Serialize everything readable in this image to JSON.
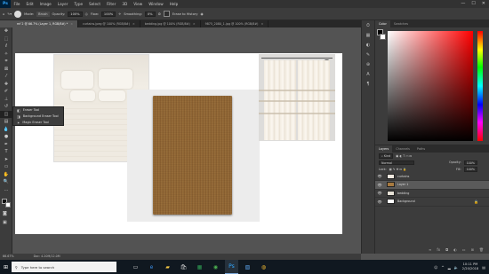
{
  "menubar": {
    "logo": "Ps",
    "items": [
      "File",
      "Edit",
      "Image",
      "Layer",
      "Type",
      "Select",
      "Filter",
      "3D",
      "View",
      "Window",
      "Help"
    ],
    "window_buttons": [
      "—",
      "☐",
      "✕"
    ]
  },
  "options": {
    "mode_label": "Mode:",
    "mode_value": "Brush",
    "opacity_label": "Opacity:",
    "opacity_value": "100%",
    "flow_label": "Flow:",
    "flow_value": "100%",
    "smoothing_label": "Smoothing:",
    "smoothing_value": "0%",
    "erase_history_label": "Erase to History"
  },
  "tabs": [
    {
      "label": "mf 2 @ 66.7% (Layer 1, RGB/8#) *",
      "active": true
    },
    {
      "label": "curtains.jpeg @ 100% (RGB/8#)",
      "active": false
    },
    {
      "label": "bedding.jpg @ 100% (RGB/8#)",
      "active": false
    },
    {
      "label": "9875_2080_1.jpg @ 100% (RGB/8#)",
      "active": false
    }
  ],
  "tool_flyout": [
    {
      "label": "Eraser Tool",
      "key": "E"
    },
    {
      "label": "Background Eraser Tool",
      "key": "E"
    },
    {
      "label": "Magic Eraser Tool",
      "key": "E"
    }
  ],
  "color_panel": {
    "tabs": [
      "Color",
      "Swatches"
    ],
    "active_tab": "Color",
    "foreground": "#000000",
    "background": "#ffffff",
    "hue": "#ff0000"
  },
  "layers_panel": {
    "tabs": [
      "Layers",
      "Channels",
      "Paths"
    ],
    "active_tab": "Layers",
    "kind_label": "Kind",
    "blend_mode": "Normal",
    "opacity_label": "Opacity:",
    "opacity_value": "100%",
    "lock_label": "Lock:",
    "fill_label": "Fill:",
    "fill_value": "100%",
    "layers": [
      {
        "name": "curtains",
        "active": false,
        "locked": false
      },
      {
        "name": "Layer 1",
        "active": true,
        "locked": false
      },
      {
        "name": "bedding",
        "active": false,
        "locked": false
      },
      {
        "name": "Background",
        "active": false,
        "locked": true
      }
    ]
  },
  "status": {
    "zoom": "66.67%",
    "doc": "Doc: 4.20M/12.0M"
  },
  "taskbar": {
    "search_placeholder": "Type here to search",
    "time": "10:11 PM",
    "date": "2/20/2018"
  }
}
